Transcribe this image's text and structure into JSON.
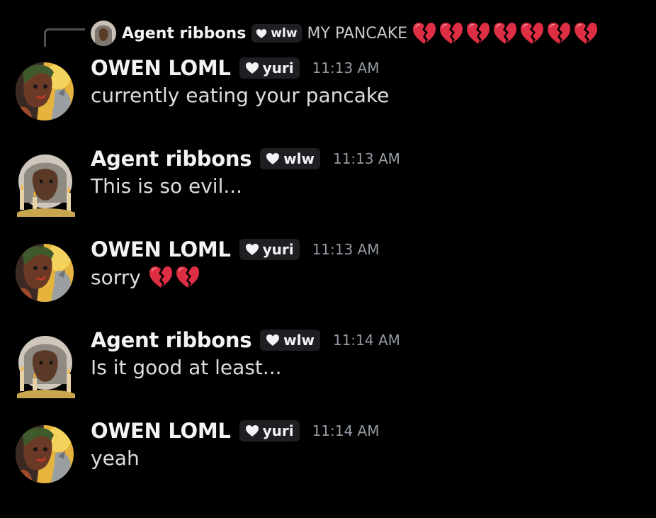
{
  "reply": {
    "author": "Agent ribbons",
    "author_tag": "wlw",
    "text": "MY PANCAKE",
    "heart_count": 7,
    "heart_icon": "broken-heart-icon"
  },
  "messages": [
    {
      "author": "OWEN LOML",
      "tag": "yuri",
      "time": "11:13 AM",
      "text": "currently eating your pancake",
      "avatar": "owen-avatar"
    },
    {
      "author": "Agent ribbons",
      "tag": "wlw",
      "time": "11:13 AM",
      "text": "This is so evil...",
      "avatar": "agent-avatar"
    },
    {
      "author": "OWEN LOML",
      "tag": "yuri",
      "time": "11:13 AM",
      "text": "sorry",
      "avatar": "owen-avatar",
      "trailing_hearts": 2
    },
    {
      "author": "Agent ribbons",
      "tag": "wlw",
      "time": "11:14 AM",
      "text": "Is it good at least...",
      "avatar": "agent-avatar"
    },
    {
      "author": "OWEN LOML",
      "tag": "yuri",
      "time": "11:14 AM",
      "text": "yeah",
      "avatar": "owen-avatar"
    }
  ],
  "colors": {
    "background": "#000000",
    "username": "#f2f3f5",
    "message_text": "#dbdee1",
    "timestamp": "#949ba4",
    "tag_background": "#1e1f22",
    "heart": "#e02a3c"
  }
}
